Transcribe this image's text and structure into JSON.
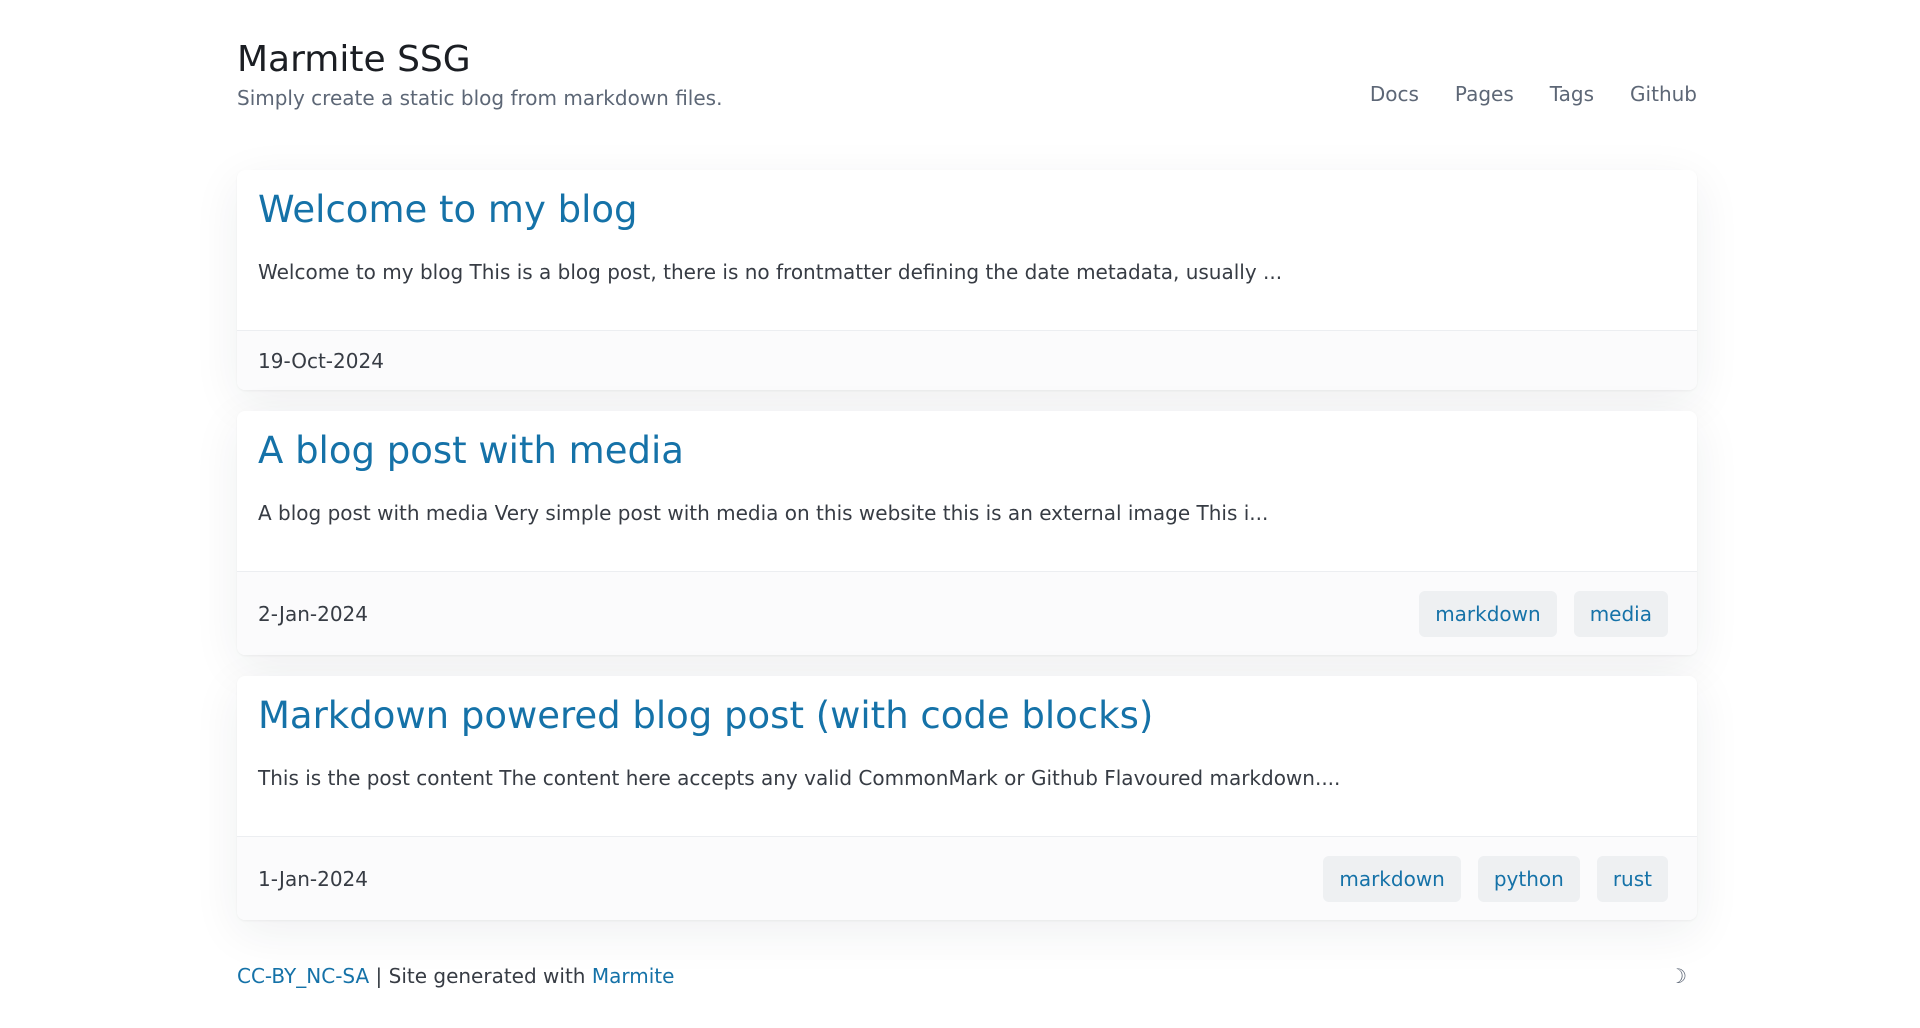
{
  "site": {
    "title": "Marmite SSG",
    "tagline": "Simply create a static blog from markdown files."
  },
  "nav": [
    {
      "label": "Docs"
    },
    {
      "label": "Pages"
    },
    {
      "label": "Tags"
    },
    {
      "label": "Github"
    }
  ],
  "posts": [
    {
      "title": "Welcome to my blog",
      "excerpt": "Welcome to my blog This is a blog post, there is no frontmatter defining the date metadata, usually ...",
      "date": "19-Oct-2024",
      "tags": []
    },
    {
      "title": "A blog post with media",
      "excerpt": "A blog post with media Very simple post with media on this website this is an external image This i...",
      "date": "2-Jan-2024",
      "tags": [
        "markdown",
        "media"
      ]
    },
    {
      "title": "Markdown powered blog post (with code blocks)",
      "excerpt": "This is the post content The content here accepts any valid CommonMark or Github Flavoured markdown....",
      "date": "1-Jan-2024",
      "tags": [
        "markdown",
        "python",
        "rust"
      ]
    }
  ],
  "footer": {
    "license_link": "CC-BY_NC-SA",
    "separator_text": " | Site generated with ",
    "generator_link": "Marmite",
    "theme_toggle_icon": "☽"
  },
  "colors": {
    "accent": "#1572a8",
    "text": "#373c44",
    "muted": "#5d6776",
    "tag_bg": "#eef0f2"
  }
}
